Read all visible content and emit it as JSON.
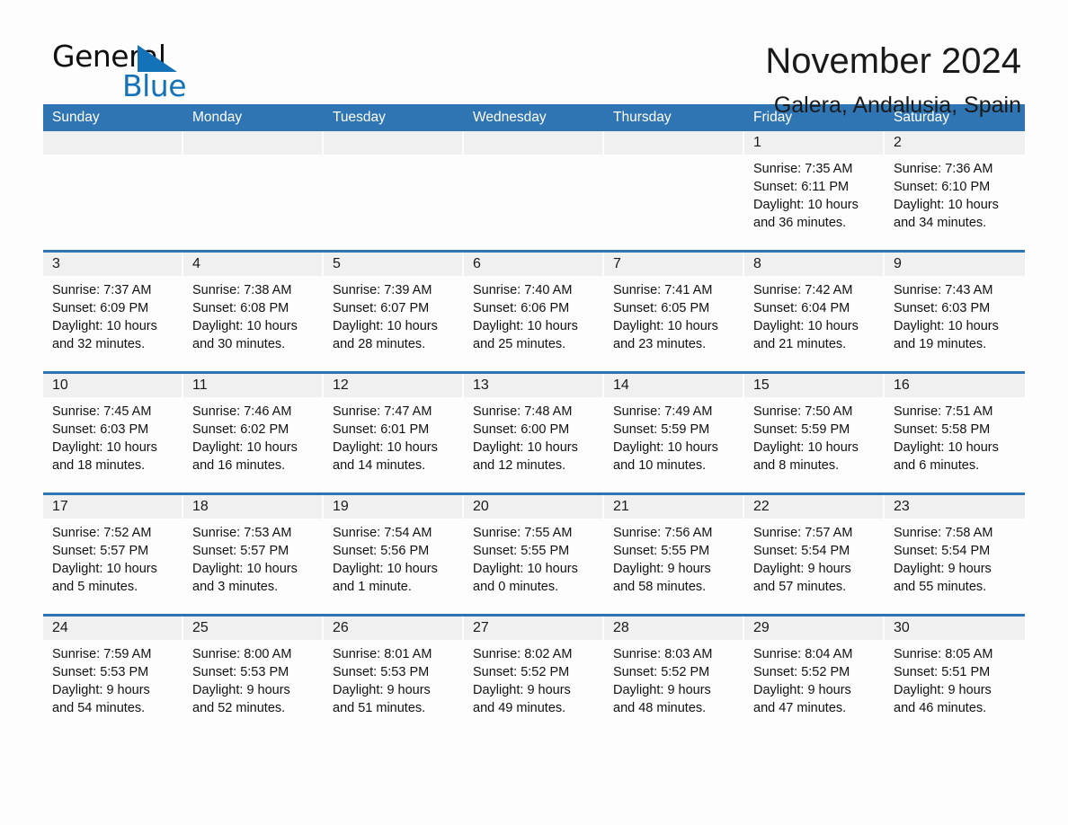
{
  "brand": {
    "name_part1": "General",
    "name_part2": "Blue",
    "triangle_icon": "triangle-icon",
    "accent_blue": "#1372b8"
  },
  "header": {
    "title": "November 2024",
    "subtitle": "Galera, Andalusia, Spain"
  },
  "colors": {
    "header_blue": "#3075b3",
    "row_divider_blue": "#3075b3",
    "daynum_band": "#f0f0f0",
    "page_background": "#fdfdfd"
  },
  "weekdays": [
    "Sunday",
    "Monday",
    "Tuesday",
    "Wednesday",
    "Thursday",
    "Friday",
    "Saturday"
  ],
  "weeks": [
    [
      {
        "day": "",
        "sunrise": "",
        "sunset": "",
        "daylight": ""
      },
      {
        "day": "",
        "sunrise": "",
        "sunset": "",
        "daylight": ""
      },
      {
        "day": "",
        "sunrise": "",
        "sunset": "",
        "daylight": ""
      },
      {
        "day": "",
        "sunrise": "",
        "sunset": "",
        "daylight": ""
      },
      {
        "day": "",
        "sunrise": "",
        "sunset": "",
        "daylight": ""
      },
      {
        "day": "1",
        "sunrise": "Sunrise: 7:35 AM",
        "sunset": "Sunset: 6:11 PM",
        "daylight": "Daylight: 10 hours and 36 minutes."
      },
      {
        "day": "2",
        "sunrise": "Sunrise: 7:36 AM",
        "sunset": "Sunset: 6:10 PM",
        "daylight": "Daylight: 10 hours and 34 minutes."
      }
    ],
    [
      {
        "day": "3",
        "sunrise": "Sunrise: 7:37 AM",
        "sunset": "Sunset: 6:09 PM",
        "daylight": "Daylight: 10 hours and 32 minutes."
      },
      {
        "day": "4",
        "sunrise": "Sunrise: 7:38 AM",
        "sunset": "Sunset: 6:08 PM",
        "daylight": "Daylight: 10 hours and 30 minutes."
      },
      {
        "day": "5",
        "sunrise": "Sunrise: 7:39 AM",
        "sunset": "Sunset: 6:07 PM",
        "daylight": "Daylight: 10 hours and 28 minutes."
      },
      {
        "day": "6",
        "sunrise": "Sunrise: 7:40 AM",
        "sunset": "Sunset: 6:06 PM",
        "daylight": "Daylight: 10 hours and 25 minutes."
      },
      {
        "day": "7",
        "sunrise": "Sunrise: 7:41 AM",
        "sunset": "Sunset: 6:05 PM",
        "daylight": "Daylight: 10 hours and 23 minutes."
      },
      {
        "day": "8",
        "sunrise": "Sunrise: 7:42 AM",
        "sunset": "Sunset: 6:04 PM",
        "daylight": "Daylight: 10 hours and 21 minutes."
      },
      {
        "day": "9",
        "sunrise": "Sunrise: 7:43 AM",
        "sunset": "Sunset: 6:03 PM",
        "daylight": "Daylight: 10 hours and 19 minutes."
      }
    ],
    [
      {
        "day": "10",
        "sunrise": "Sunrise: 7:45 AM",
        "sunset": "Sunset: 6:03 PM",
        "daylight": "Daylight: 10 hours and 18 minutes."
      },
      {
        "day": "11",
        "sunrise": "Sunrise: 7:46 AM",
        "sunset": "Sunset: 6:02 PM",
        "daylight": "Daylight: 10 hours and 16 minutes."
      },
      {
        "day": "12",
        "sunrise": "Sunrise: 7:47 AM",
        "sunset": "Sunset: 6:01 PM",
        "daylight": "Daylight: 10 hours and 14 minutes."
      },
      {
        "day": "13",
        "sunrise": "Sunrise: 7:48 AM",
        "sunset": "Sunset: 6:00 PM",
        "daylight": "Daylight: 10 hours and 12 minutes."
      },
      {
        "day": "14",
        "sunrise": "Sunrise: 7:49 AM",
        "sunset": "Sunset: 5:59 PM",
        "daylight": "Daylight: 10 hours and 10 minutes."
      },
      {
        "day": "15",
        "sunrise": "Sunrise: 7:50 AM",
        "sunset": "Sunset: 5:59 PM",
        "daylight": "Daylight: 10 hours and 8 minutes."
      },
      {
        "day": "16",
        "sunrise": "Sunrise: 7:51 AM",
        "sunset": "Sunset: 5:58 PM",
        "daylight": "Daylight: 10 hours and 6 minutes."
      }
    ],
    [
      {
        "day": "17",
        "sunrise": "Sunrise: 7:52 AM",
        "sunset": "Sunset: 5:57 PM",
        "daylight": "Daylight: 10 hours and 5 minutes."
      },
      {
        "day": "18",
        "sunrise": "Sunrise: 7:53 AM",
        "sunset": "Sunset: 5:57 PM",
        "daylight": "Daylight: 10 hours and 3 minutes."
      },
      {
        "day": "19",
        "sunrise": "Sunrise: 7:54 AM",
        "sunset": "Sunset: 5:56 PM",
        "daylight": "Daylight: 10 hours and 1 minute."
      },
      {
        "day": "20",
        "sunrise": "Sunrise: 7:55 AM",
        "sunset": "Sunset: 5:55 PM",
        "daylight": "Daylight: 10 hours and 0 minutes."
      },
      {
        "day": "21",
        "sunrise": "Sunrise: 7:56 AM",
        "sunset": "Sunset: 5:55 PM",
        "daylight": "Daylight: 9 hours and 58 minutes."
      },
      {
        "day": "22",
        "sunrise": "Sunrise: 7:57 AM",
        "sunset": "Sunset: 5:54 PM",
        "daylight": "Daylight: 9 hours and 57 minutes."
      },
      {
        "day": "23",
        "sunrise": "Sunrise: 7:58 AM",
        "sunset": "Sunset: 5:54 PM",
        "daylight": "Daylight: 9 hours and 55 minutes."
      }
    ],
    [
      {
        "day": "24",
        "sunrise": "Sunrise: 7:59 AM",
        "sunset": "Sunset: 5:53 PM",
        "daylight": "Daylight: 9 hours and 54 minutes."
      },
      {
        "day": "25",
        "sunrise": "Sunrise: 8:00 AM",
        "sunset": "Sunset: 5:53 PM",
        "daylight": "Daylight: 9 hours and 52 minutes."
      },
      {
        "day": "26",
        "sunrise": "Sunrise: 8:01 AM",
        "sunset": "Sunset: 5:53 PM",
        "daylight": "Daylight: 9 hours and 51 minutes."
      },
      {
        "day": "27",
        "sunrise": "Sunrise: 8:02 AM",
        "sunset": "Sunset: 5:52 PM",
        "daylight": "Daylight: 9 hours and 49 minutes."
      },
      {
        "day": "28",
        "sunrise": "Sunrise: 8:03 AM",
        "sunset": "Sunset: 5:52 PM",
        "daylight": "Daylight: 9 hours and 48 minutes."
      },
      {
        "day": "29",
        "sunrise": "Sunrise: 8:04 AM",
        "sunset": "Sunset: 5:52 PM",
        "daylight": "Daylight: 9 hours and 47 minutes."
      },
      {
        "day": "30",
        "sunrise": "Sunrise: 8:05 AM",
        "sunset": "Sunset: 5:51 PM",
        "daylight": "Daylight: 9 hours and 46 minutes."
      }
    ]
  ]
}
